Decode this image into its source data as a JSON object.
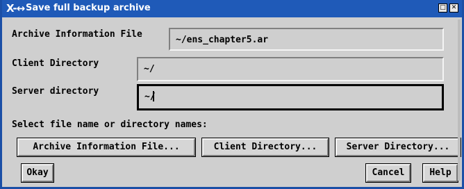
{
  "window": {
    "title": "Save full backup archive",
    "icon_glyph": "X-↔",
    "icon_name": "app-icon",
    "minimize_glyph": "□",
    "close_glyph": "✕",
    "accent_color": "#1f5ab8"
  },
  "fields": {
    "archive": {
      "label": "Archive Information File",
      "value": "~/ens_chapter5.ar"
    },
    "client": {
      "label": "Client Directory",
      "value": "~/"
    },
    "server": {
      "label": "Server directory",
      "value": "~/"
    }
  },
  "select_prompt": "Select file name or directory names:",
  "buttons": {
    "archive_file": "Archive Information File...",
    "client_dir": "Client Directory...",
    "server_dir": "Server Directory...",
    "okay": "Okay",
    "cancel": "Cancel",
    "help": "Help"
  }
}
